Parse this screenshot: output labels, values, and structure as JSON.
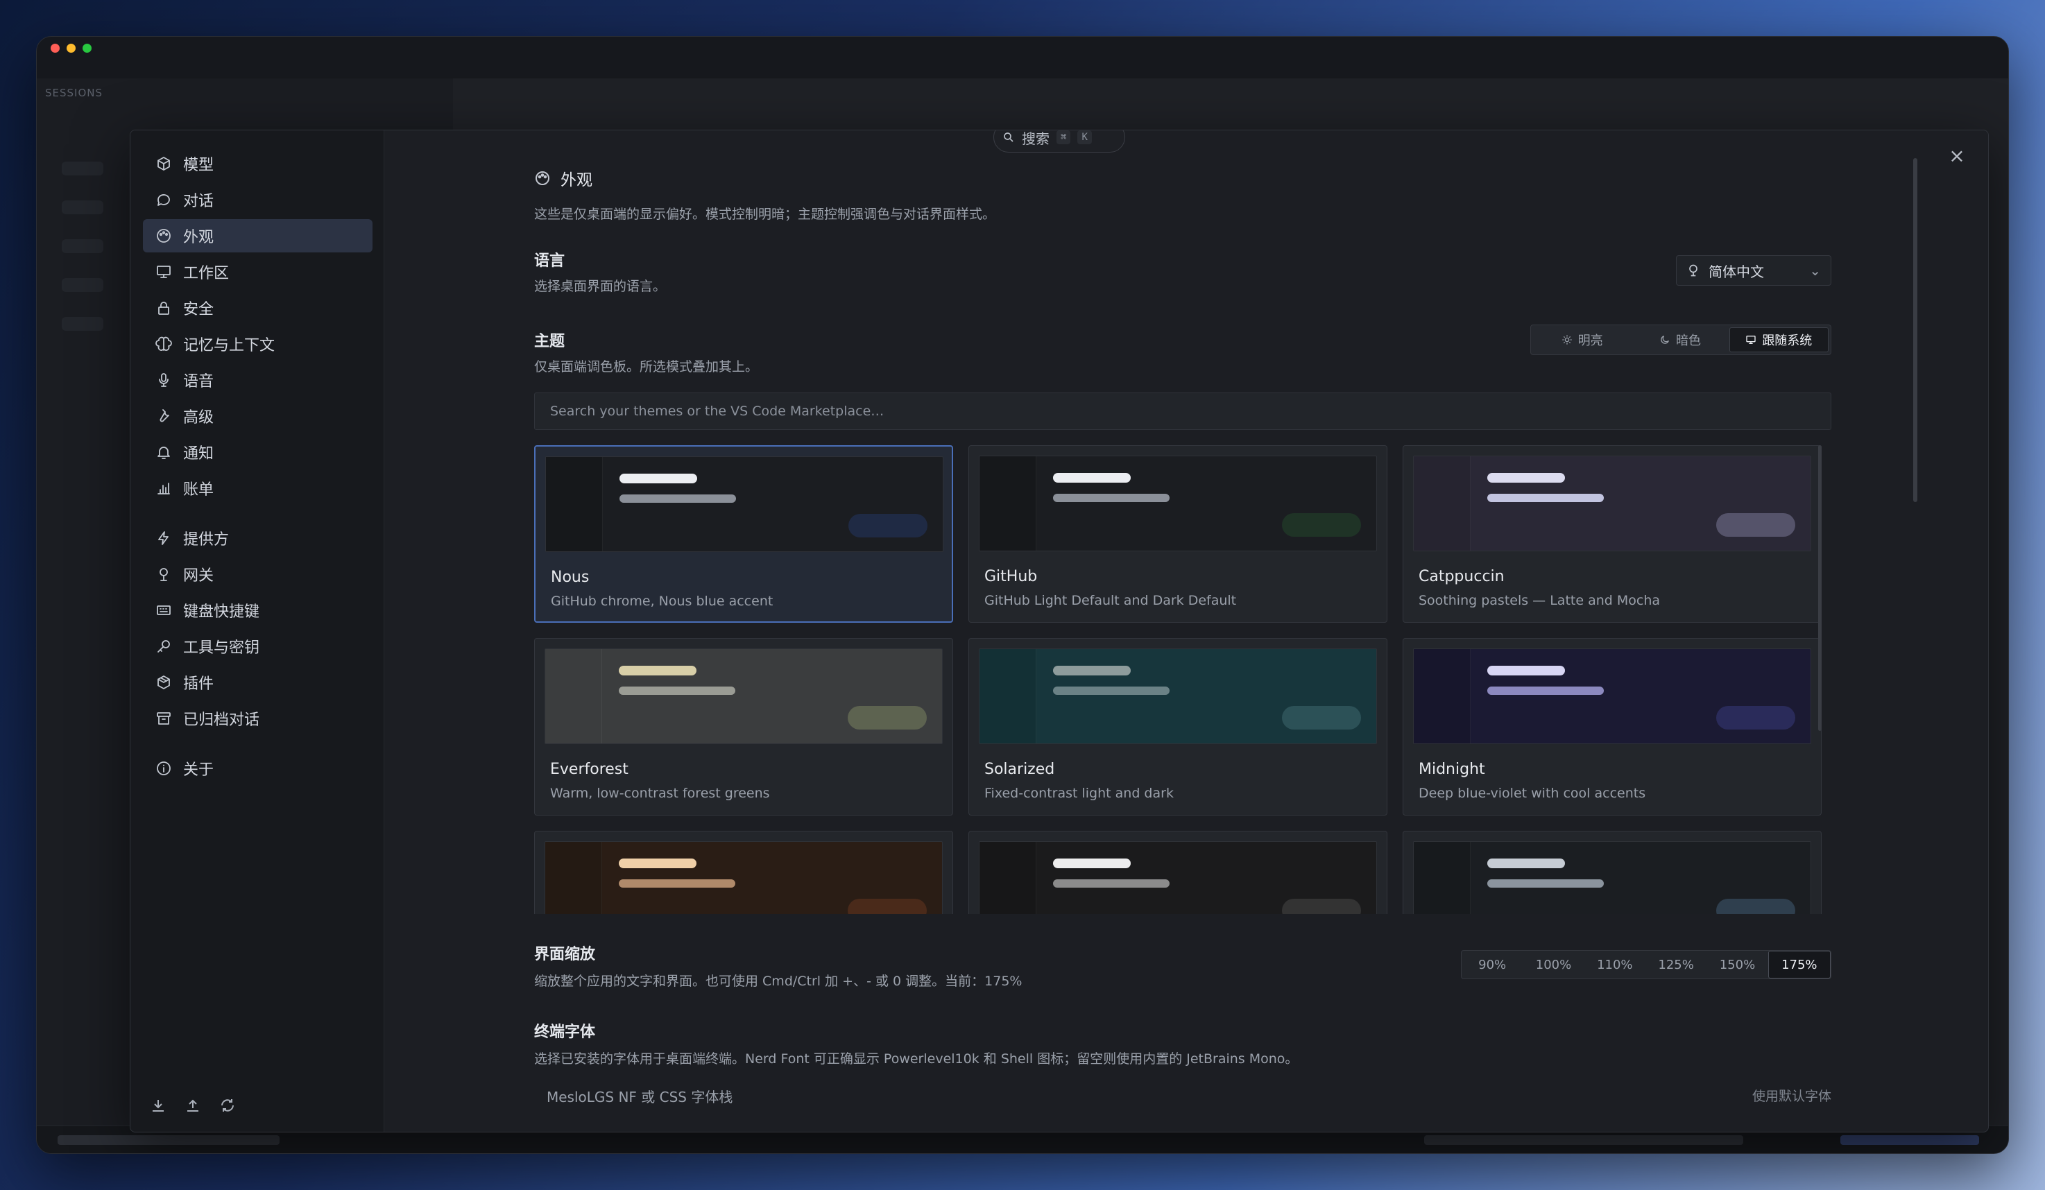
{
  "search": {
    "label": "搜索",
    "kbd1": "⌘",
    "kbd2": "K"
  },
  "nav": {
    "items": [
      {
        "label": "模型",
        "icon": "cube-icon"
      },
      {
        "label": "对话",
        "icon": "chat-icon"
      },
      {
        "label": "外观",
        "icon": "palette-icon",
        "active": true
      },
      {
        "label": "工作区",
        "icon": "monitor-icon"
      },
      {
        "label": "安全",
        "icon": "lock-icon"
      },
      {
        "label": "记忆与上下文",
        "icon": "brain-icon"
      },
      {
        "label": "语音",
        "icon": "mic-icon"
      },
      {
        "label": "高级",
        "icon": "wrench-icon"
      },
      {
        "label": "通知",
        "icon": "bell-icon"
      },
      {
        "label": "账单",
        "icon": "chart-icon"
      },
      {
        "label": "提供方",
        "icon": "bolt-icon"
      },
      {
        "label": "网关",
        "icon": "gateway-icon"
      },
      {
        "label": "键盘快捷键",
        "icon": "keyboard-icon"
      },
      {
        "label": "工具与密钥",
        "icon": "key-icon"
      },
      {
        "label": "插件",
        "icon": "package-icon"
      },
      {
        "label": "已归档对话",
        "icon": "archive-icon"
      },
      {
        "label": "关于",
        "icon": "info-icon"
      }
    ]
  },
  "appearance": {
    "title": "外观",
    "desc": "这些是仅桌面端的显示偏好。模式控制明暗；主题控制强调色与对话界面样式。"
  },
  "language": {
    "title": "语言",
    "desc": "选择桌面界面的语言。",
    "selected": "简体中文"
  },
  "theme": {
    "title": "主题",
    "desc": "仅桌面端调色板。所选模式叠加其上。",
    "modes": [
      "明亮",
      "暗色",
      "跟随系统"
    ],
    "active_mode": "跟随系统",
    "search_placeholder": "Search your themes or the VS Code Marketplace…",
    "cards": [
      {
        "name": "Nous",
        "desc": "GitHub chrome, Nous blue accent",
        "active": true,
        "colors": {
          "bg": "#1b1d21",
          "side": "#16181b",
          "l1": "#eceef2",
          "l2": "#8b9099",
          "pill": "#1f2a44"
        }
      },
      {
        "name": "GitHub",
        "desc": "GitHub Light Default and Dark Default",
        "colors": {
          "bg": "#1b1d21",
          "side": "#16181b",
          "l1": "#eceef2",
          "l2": "#8b9099",
          "pill": "#1f3326"
        }
      },
      {
        "name": "Catppuccin",
        "desc": "Soothing pastels — Latte and Mocha",
        "colors": {
          "bg": "#2a2836",
          "side": "#262430",
          "l1": "#dcdcf0",
          "l2": "#c2c4e0",
          "pill": "#55536a"
        }
      },
      {
        "name": "Everforest",
        "desc": "Warm, low-contrast forest greens",
        "colors": {
          "bg": "#3b3d3e",
          "side": "#3b3d3e",
          "l1": "#d8cfa8",
          "l2": "#9a9c94",
          "pill": "#5d6350"
        }
      },
      {
        "name": "Solarized",
        "desc": "Fixed-contrast light and dark",
        "colors": {
          "bg": "#17363c",
          "side": "#133035",
          "l1": "#8e9c9c",
          "l2": "#6b8286",
          "pill": "#2c5157"
        }
      },
      {
        "name": "Midnight",
        "desc": "Deep blue-violet with cool accents",
        "colors": {
          "bg": "#1b1a33",
          "side": "#17162c",
          "l1": "#d8d6f4",
          "l2": "#8c89bf",
          "pill": "#2a2b5a"
        }
      },
      {
        "name": "",
        "desc": "",
        "colors": {
          "bg": "#2a1d15",
          "side": "#241a13",
          "l1": "#f0d0a8",
          "l2": "#b08a6a",
          "pill": "#4a2a1a"
        }
      },
      {
        "name": "",
        "desc": "",
        "colors": {
          "bg": "#1b1b1c",
          "side": "#171718",
          "l1": "#ededed",
          "l2": "#8b8b8b",
          "pill": "#333333"
        }
      },
      {
        "name": "",
        "desc": "",
        "colors": {
          "bg": "#1b1e22",
          "side": "#171a1d",
          "l1": "#c6ccd4",
          "l2": "#8b949e",
          "pill": "#2f3f4e"
        }
      }
    ]
  },
  "zoom": {
    "title": "界面缩放",
    "desc": "缩放整个应用的文字和界面。也可使用 Cmd/Ctrl 加 +、- 或 0 调整。当前：175%",
    "options": [
      "90%",
      "100%",
      "110%",
      "125%",
      "150%",
      "175%"
    ],
    "active": "175%"
  },
  "terminal_font": {
    "title": "终端字体",
    "desc": "选择已安装的字体用于桌面端终端。Nerd Font 可正确显示 Powerlevel10k 和 Shell 图标；留空则使用内置的 JetBrains Mono。",
    "placeholder": "MesloLGS NF 或 CSS 字体栈",
    "default_label": "使用默认字体"
  },
  "background_app": {
    "sessions_tab": "SESSIONS"
  }
}
